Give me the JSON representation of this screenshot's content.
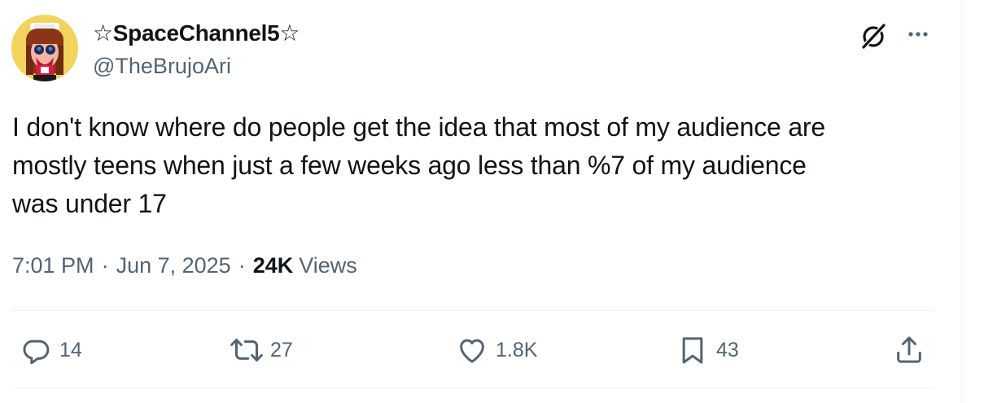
{
  "author": {
    "display_name": "☆SpaceChannel5☆",
    "handle": "@TheBrujoAri"
  },
  "post": {
    "text": "I don't know where do people get the idea that most of my audience are\nmostly teens when just a few weeks ago less than %7 of my audience\nwas under 17",
    "time": "7:01 PM",
    "separator": "·",
    "date": "Jun 7, 2025",
    "views_count": "24K",
    "views_label": "Views"
  },
  "actions": {
    "replies": "14",
    "reposts": "27",
    "likes": "1.8K",
    "bookmarks": "43"
  },
  "icons": {
    "grok": "grok-icon",
    "more": "more-icon",
    "reply": "reply-icon",
    "repost": "repost-icon",
    "like": "heart-icon",
    "bookmark": "bookmark-icon",
    "share": "share-icon"
  },
  "colors": {
    "text_primary": "#0f1419",
    "text_secondary": "#536471",
    "divider": "#eff3f4",
    "avatar_bg": "#f2d35c"
  }
}
